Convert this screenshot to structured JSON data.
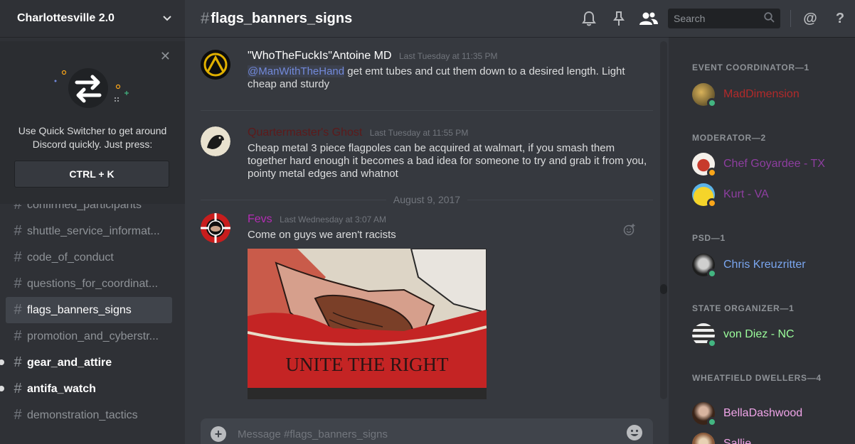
{
  "server": {
    "name": "Charlottesville 2.0"
  },
  "quick_switcher": {
    "text_line1": "Use Quick Switcher to get around",
    "text_line2": "Discord quickly. Just press:",
    "shortcut": "CTRL + K"
  },
  "channels": [
    {
      "name": "confirmed_participants",
      "state": "normal"
    },
    {
      "name": "shuttle_service_informat...",
      "state": "normal"
    },
    {
      "name": "code_of_conduct",
      "state": "normal"
    },
    {
      "name": "questions_for_coordinat...",
      "state": "normal"
    },
    {
      "name": "flags_banners_signs",
      "state": "selected"
    },
    {
      "name": "promotion_and_cyberstr...",
      "state": "normal"
    },
    {
      "name": "gear_and_attire",
      "state": "unread"
    },
    {
      "name": "antifa_watch",
      "state": "unread"
    },
    {
      "name": "demonstration_tactics",
      "state": "normal"
    }
  ],
  "header": {
    "hash": "#",
    "channel": "flags_banners_signs",
    "search_placeholder": "Search"
  },
  "messages": [
    {
      "author": "\"WhoTheFuckIs\"Antoine MD",
      "author_color": "#ffffff",
      "timestamp": "Last Tuesday at 11:35 PM",
      "mention": "@ManWithTheHand",
      "text": " get emt tubes and cut them down to a desired length. Light cheap and sturdy"
    },
    {
      "author": "Quartermaster's Ghost",
      "author_color": "#5c1a1b",
      "timestamp": "Last Tuesday at 11:55 PM",
      "text": "Cheap metal 3 piece flagpoles can be acquired at walmart, if you smash them together hard enough it becomes a bad idea for someone to try and grab it from you, pointy metal edges and whatnot"
    },
    {
      "author": "Fevs",
      "author_color": "#b42db4",
      "timestamp": "Last Wednesday at 3:07 AM",
      "text": "Come on guys we aren't racists",
      "image_caption": "UNITE THE RIGHT"
    }
  ],
  "date_divider": "August 9, 2017",
  "composer": {
    "placeholder": "Message #flags_banners_signs"
  },
  "members": {
    "roles": [
      {
        "title": "EVENT COORDINATOR—1",
        "members": [
          {
            "name": "MadDimension",
            "color": "#b22a2a",
            "status": "online"
          }
        ]
      },
      {
        "title": "MODERATOR—2",
        "members": [
          {
            "name": "Chef Goyardee - TX",
            "color": "#8e3ea0",
            "status": "idle"
          },
          {
            "name": "Kurt - VA",
            "color": "#8e3ea0",
            "status": "idle"
          }
        ]
      },
      {
        "title": "PSD—1",
        "members": [
          {
            "name": "Chris Kreuzritter",
            "color": "#7aa6f0",
            "status": "online"
          }
        ]
      },
      {
        "title": "STATE ORGANIZER—1",
        "members": [
          {
            "name": "von Diez - NC",
            "color": "#9cff9c",
            "status": "online"
          }
        ]
      },
      {
        "title": "WHEATFIELD DWELLERS—4",
        "members": [
          {
            "name": "BellaDashwood",
            "color": "#f0a4e8",
            "status": "online"
          },
          {
            "name": "Sallie",
            "color": "#f0a4e8",
            "status": "online"
          }
        ]
      }
    ]
  },
  "colors": {
    "online": "#43b581",
    "idle": "#faa61a",
    "accent": "#7289da"
  }
}
